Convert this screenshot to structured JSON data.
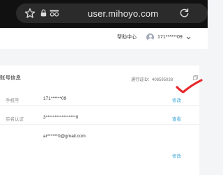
{
  "browser": {
    "url": "user.mihoyo.com",
    "icons": [
      "star-outline-icon",
      "lock-icon",
      "incognito-icon",
      "reload-icon"
    ]
  },
  "header": {
    "help_label": "帮助中心",
    "user_name": "171******09",
    "icons": [
      "avatar",
      "chevron-down-icon"
    ]
  },
  "account": {
    "section_title": "账号信息",
    "user_id": "通行证ID：408595038",
    "rows": [
      {
        "label": "手机号",
        "value": "171******09",
        "action": "修改"
      },
      {
        "label": "实名认证",
        "value": "3*****************0",
        "action": "查看"
      },
      {
        "label": "",
        "value": "ar******0@gmail.com",
        "action": ""
      },
      {
        "label": "",
        "value": "",
        "action": "修改"
      }
    ]
  },
  "annotation": {
    "color": "#e8272c",
    "shape": "check-mark"
  }
}
